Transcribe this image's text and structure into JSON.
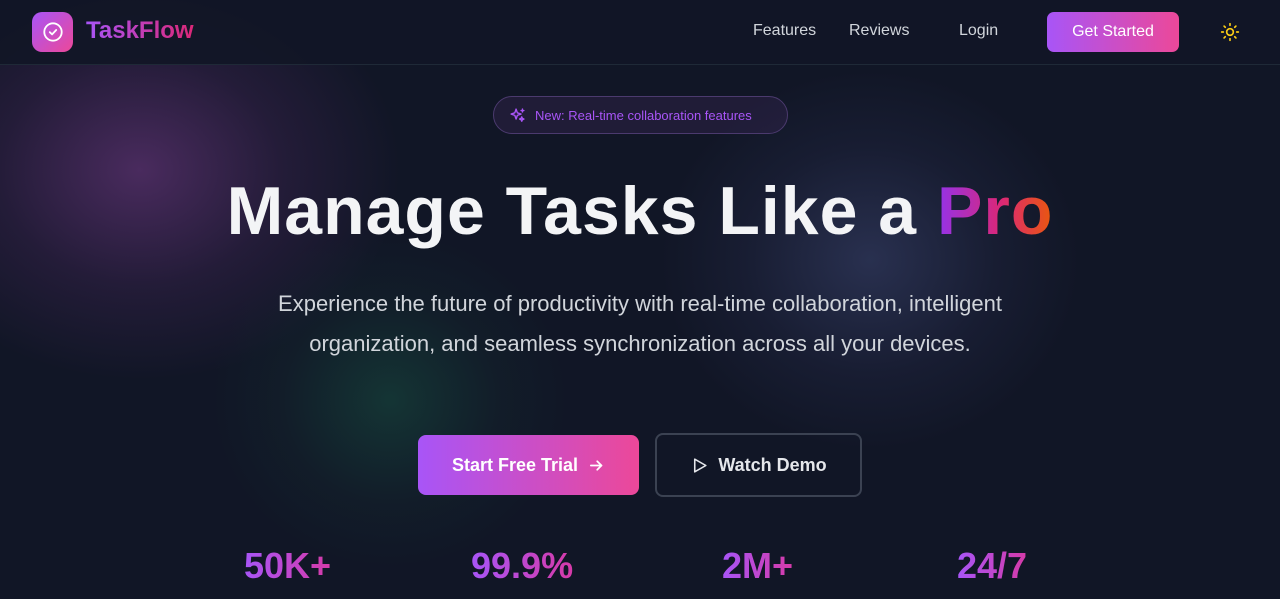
{
  "app": {
    "name": "TaskFlow"
  },
  "nav": {
    "features": "Features",
    "reviews": "Reviews",
    "login": "Login",
    "cta": "Get Started"
  },
  "icons": {
    "logo": "check-circle-icon",
    "theme": "sun-icon",
    "badge": "sparkles-icon",
    "trial": "arrow-right-icon",
    "demo": "play-icon"
  },
  "hero": {
    "badge": "New: Real-time collaboration features",
    "title_main": "Manage Tasks Like a ",
    "title_accent": "Pro",
    "subtitle": "Experience the future of productivity with real-time collaboration, intelligent organization, and seamless synchronization across all your devices.",
    "primary_cta": "Start Free Trial",
    "secondary_cta": "Watch Demo"
  },
  "stats": [
    "50K+",
    "99.9%",
    "2M+",
    "24/7"
  ],
  "colors": {
    "background": "#111626",
    "brand_purple": "#a855f7",
    "brand_pink": "#ec4899",
    "sun": "#facc15"
  }
}
